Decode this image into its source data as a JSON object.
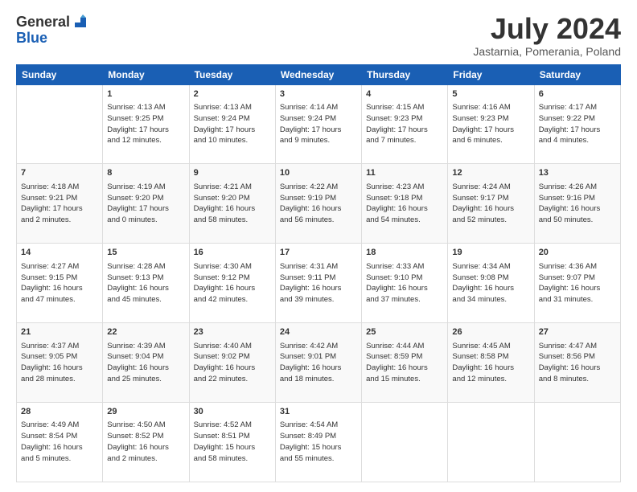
{
  "logo": {
    "text_general": "General",
    "text_blue": "Blue"
  },
  "header": {
    "title": "July 2024",
    "subtitle": "Jastarnia, Pomerania, Poland"
  },
  "days_of_week": [
    "Sunday",
    "Monday",
    "Tuesday",
    "Wednesday",
    "Thursday",
    "Friday",
    "Saturday"
  ],
  "weeks": [
    [
      {
        "day": "",
        "info": ""
      },
      {
        "day": "1",
        "info": "Sunrise: 4:13 AM\nSunset: 9:25 PM\nDaylight: 17 hours\nand 12 minutes."
      },
      {
        "day": "2",
        "info": "Sunrise: 4:13 AM\nSunset: 9:24 PM\nDaylight: 17 hours\nand 10 minutes."
      },
      {
        "day": "3",
        "info": "Sunrise: 4:14 AM\nSunset: 9:24 PM\nDaylight: 17 hours\nand 9 minutes."
      },
      {
        "day": "4",
        "info": "Sunrise: 4:15 AM\nSunset: 9:23 PM\nDaylight: 17 hours\nand 7 minutes."
      },
      {
        "day": "5",
        "info": "Sunrise: 4:16 AM\nSunset: 9:23 PM\nDaylight: 17 hours\nand 6 minutes."
      },
      {
        "day": "6",
        "info": "Sunrise: 4:17 AM\nSunset: 9:22 PM\nDaylight: 17 hours\nand 4 minutes."
      }
    ],
    [
      {
        "day": "7",
        "info": "Sunrise: 4:18 AM\nSunset: 9:21 PM\nDaylight: 17 hours\nand 2 minutes."
      },
      {
        "day": "8",
        "info": "Sunrise: 4:19 AM\nSunset: 9:20 PM\nDaylight: 17 hours\nand 0 minutes."
      },
      {
        "day": "9",
        "info": "Sunrise: 4:21 AM\nSunset: 9:20 PM\nDaylight: 16 hours\nand 58 minutes."
      },
      {
        "day": "10",
        "info": "Sunrise: 4:22 AM\nSunset: 9:19 PM\nDaylight: 16 hours\nand 56 minutes."
      },
      {
        "day": "11",
        "info": "Sunrise: 4:23 AM\nSunset: 9:18 PM\nDaylight: 16 hours\nand 54 minutes."
      },
      {
        "day": "12",
        "info": "Sunrise: 4:24 AM\nSunset: 9:17 PM\nDaylight: 16 hours\nand 52 minutes."
      },
      {
        "day": "13",
        "info": "Sunrise: 4:26 AM\nSunset: 9:16 PM\nDaylight: 16 hours\nand 50 minutes."
      }
    ],
    [
      {
        "day": "14",
        "info": "Sunrise: 4:27 AM\nSunset: 9:15 PM\nDaylight: 16 hours\nand 47 minutes."
      },
      {
        "day": "15",
        "info": "Sunrise: 4:28 AM\nSunset: 9:13 PM\nDaylight: 16 hours\nand 45 minutes."
      },
      {
        "day": "16",
        "info": "Sunrise: 4:30 AM\nSunset: 9:12 PM\nDaylight: 16 hours\nand 42 minutes."
      },
      {
        "day": "17",
        "info": "Sunrise: 4:31 AM\nSunset: 9:11 PM\nDaylight: 16 hours\nand 39 minutes."
      },
      {
        "day": "18",
        "info": "Sunrise: 4:33 AM\nSunset: 9:10 PM\nDaylight: 16 hours\nand 37 minutes."
      },
      {
        "day": "19",
        "info": "Sunrise: 4:34 AM\nSunset: 9:08 PM\nDaylight: 16 hours\nand 34 minutes."
      },
      {
        "day": "20",
        "info": "Sunrise: 4:36 AM\nSunset: 9:07 PM\nDaylight: 16 hours\nand 31 minutes."
      }
    ],
    [
      {
        "day": "21",
        "info": "Sunrise: 4:37 AM\nSunset: 9:05 PM\nDaylight: 16 hours\nand 28 minutes."
      },
      {
        "day": "22",
        "info": "Sunrise: 4:39 AM\nSunset: 9:04 PM\nDaylight: 16 hours\nand 25 minutes."
      },
      {
        "day": "23",
        "info": "Sunrise: 4:40 AM\nSunset: 9:02 PM\nDaylight: 16 hours\nand 22 minutes."
      },
      {
        "day": "24",
        "info": "Sunrise: 4:42 AM\nSunset: 9:01 PM\nDaylight: 16 hours\nand 18 minutes."
      },
      {
        "day": "25",
        "info": "Sunrise: 4:44 AM\nSunset: 8:59 PM\nDaylight: 16 hours\nand 15 minutes."
      },
      {
        "day": "26",
        "info": "Sunrise: 4:45 AM\nSunset: 8:58 PM\nDaylight: 16 hours\nand 12 minutes."
      },
      {
        "day": "27",
        "info": "Sunrise: 4:47 AM\nSunset: 8:56 PM\nDaylight: 16 hours\nand 8 minutes."
      }
    ],
    [
      {
        "day": "28",
        "info": "Sunrise: 4:49 AM\nSunset: 8:54 PM\nDaylight: 16 hours\nand 5 minutes."
      },
      {
        "day": "29",
        "info": "Sunrise: 4:50 AM\nSunset: 8:52 PM\nDaylight: 16 hours\nand 2 minutes."
      },
      {
        "day": "30",
        "info": "Sunrise: 4:52 AM\nSunset: 8:51 PM\nDaylight: 15 hours\nand 58 minutes."
      },
      {
        "day": "31",
        "info": "Sunrise: 4:54 AM\nSunset: 8:49 PM\nDaylight: 15 hours\nand 55 minutes."
      },
      {
        "day": "",
        "info": ""
      },
      {
        "day": "",
        "info": ""
      },
      {
        "day": "",
        "info": ""
      }
    ]
  ]
}
